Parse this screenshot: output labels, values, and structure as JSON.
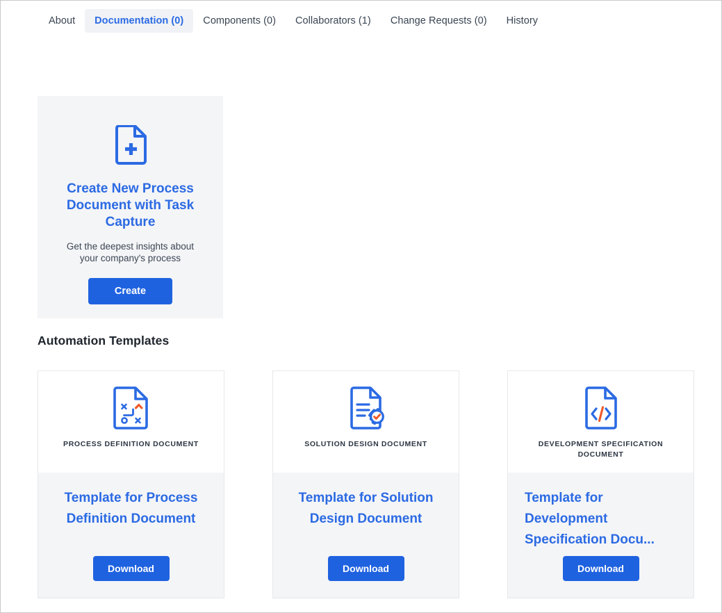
{
  "tabs": [
    {
      "label": "About",
      "active": false
    },
    {
      "label": "Documentation (0)",
      "active": true
    },
    {
      "label": "Components (0)",
      "active": false
    },
    {
      "label": "Collaborators (1)",
      "active": false
    },
    {
      "label": "Change Requests (0)",
      "active": false
    },
    {
      "label": "History",
      "active": false
    }
  ],
  "create_card": {
    "icon": "document-plus-icon",
    "title": "Create New Process Document with Task Capture",
    "subtitle": "Get the deepest insights about your company's process",
    "button_label": "Create"
  },
  "section": {
    "heading": "Automation Templates"
  },
  "templates": [
    {
      "icon": "document-strategy-icon",
      "label": "PROCESS DEFINITION DOCUMENT",
      "title": "Template for Process Definition Document",
      "button_label": "Download"
    },
    {
      "icon": "document-gear-check-icon",
      "label": "SOLUTION DESIGN DOCUMENT",
      "title": "Template for Solution Design Document",
      "button_label": "Download"
    },
    {
      "icon": "document-code-icon",
      "label": "DEVELOPMENT SPECIFICATION DOCUMENT",
      "title": "Template for Development Specification Docu...",
      "button_label": "Download"
    }
  ],
  "colors": {
    "accent_blue": "#2b6ae3",
    "button_blue": "#1f62e0",
    "accent_orange": "#f05a28",
    "card_gray": "#f4f5f7",
    "text_dark": "#20262e"
  }
}
